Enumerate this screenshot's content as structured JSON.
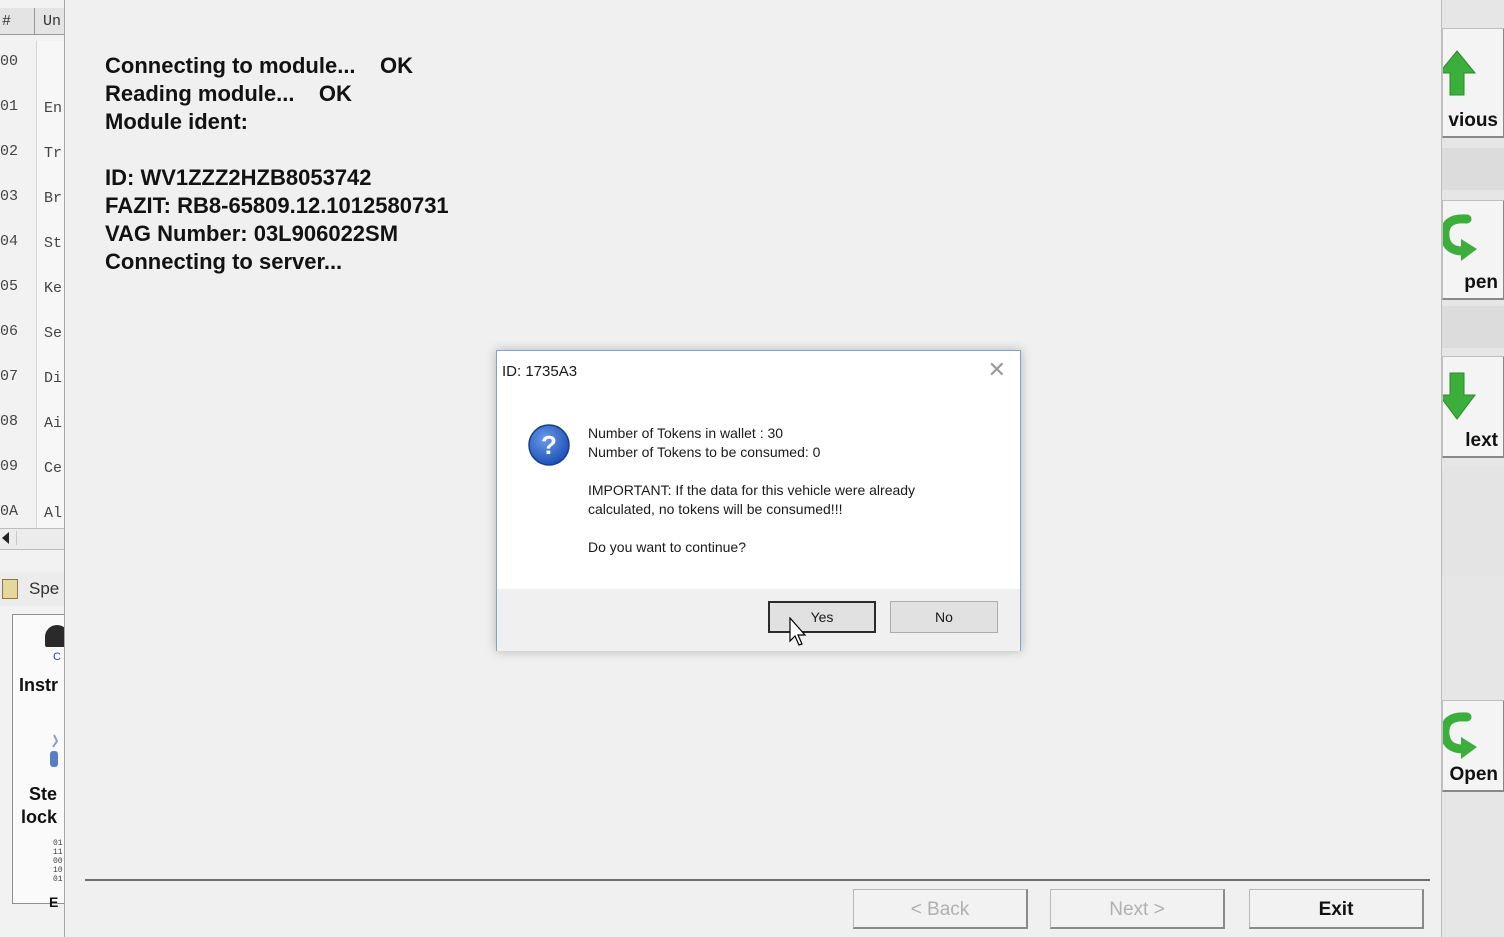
{
  "left_list": {
    "header_num": "#",
    "header_name": "Un",
    "rows": [
      {
        "num": "00",
        "name": ""
      },
      {
        "num": "01",
        "name": "En"
      },
      {
        "num": "02",
        "name": "Tr"
      },
      {
        "num": "03",
        "name": "Br"
      },
      {
        "num": "04",
        "name": "St"
      },
      {
        "num": "05",
        "name": "Ke"
      },
      {
        "num": "06",
        "name": "Se"
      },
      {
        "num": "07",
        "name": "Di"
      },
      {
        "num": "08",
        "name": "Ai"
      },
      {
        "num": "09",
        "name": "Ce"
      },
      {
        "num": "0A",
        "name": "Al"
      }
    ],
    "special_label": "Spe",
    "items": {
      "instruments_label": "Instr",
      "steering_lock_line1": "Ste",
      "steering_lock_line2": "lock",
      "partial_label": "E"
    }
  },
  "log": {
    "lines": [
      "Connecting to module...    OK",
      "Reading module...    OK",
      "Module ident:",
      "",
      "ID: WV1ZZZ2HZB8053742",
      "FAZIT: RB8-65809.12.1012580731",
      "VAG Number: 03L906022SM",
      "Connecting to server..."
    ]
  },
  "dialog": {
    "title": "ID: 1735A3",
    "close_glyph": "✕",
    "icon": "question-icon",
    "line1": "Number of Tokens in wallet : 30",
    "line2": "Number of Tokens to be consumed: 0",
    "line3": "IMPORTANT: If the data for this vehicle were already",
    "line4": "calculated, no tokens will be consumed!!!",
    "line5": "Do you want to continue?",
    "yes_label": "Yes",
    "no_label": "No"
  },
  "right_toolbar": {
    "previous_label": "vious",
    "open_label_1": "pen",
    "next_label": "lext",
    "open_label_2": "Open"
  },
  "footer": {
    "back_label": "< Back",
    "next_label": "Next >",
    "exit_label": "Exit"
  },
  "colors": {
    "arrow_green": "#3cae3c",
    "dialog_border": "#7fa6c9",
    "question_blue": "#1f52b8"
  }
}
